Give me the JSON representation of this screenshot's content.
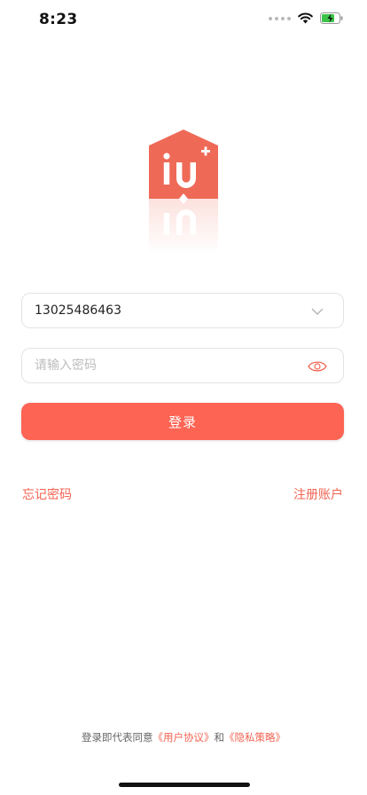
{
  "status_bar": {
    "time": "8:23",
    "icons": [
      "signal-dots-icon",
      "wifi-icon",
      "battery-charging-icon"
    ]
  },
  "logo": {
    "text": "iu+"
  },
  "account": {
    "value": "13025486463",
    "dropdown_icon": "chevron-down-icon"
  },
  "password": {
    "placeholder": "请输入密码",
    "toggle_icon": "eye-icon"
  },
  "login_button": {
    "label": "登录"
  },
  "links": {
    "forgot_password": "忘记密码",
    "register": "注册账户"
  },
  "agreement": {
    "prefix": "登录即代表同意",
    "user_agreement": "《用户协议》",
    "connector": "和",
    "privacy_policy": "《隐私策略》"
  },
  "colors": {
    "accent": "#fd6454",
    "link": "#f26352",
    "logo": "#ee6a57"
  }
}
